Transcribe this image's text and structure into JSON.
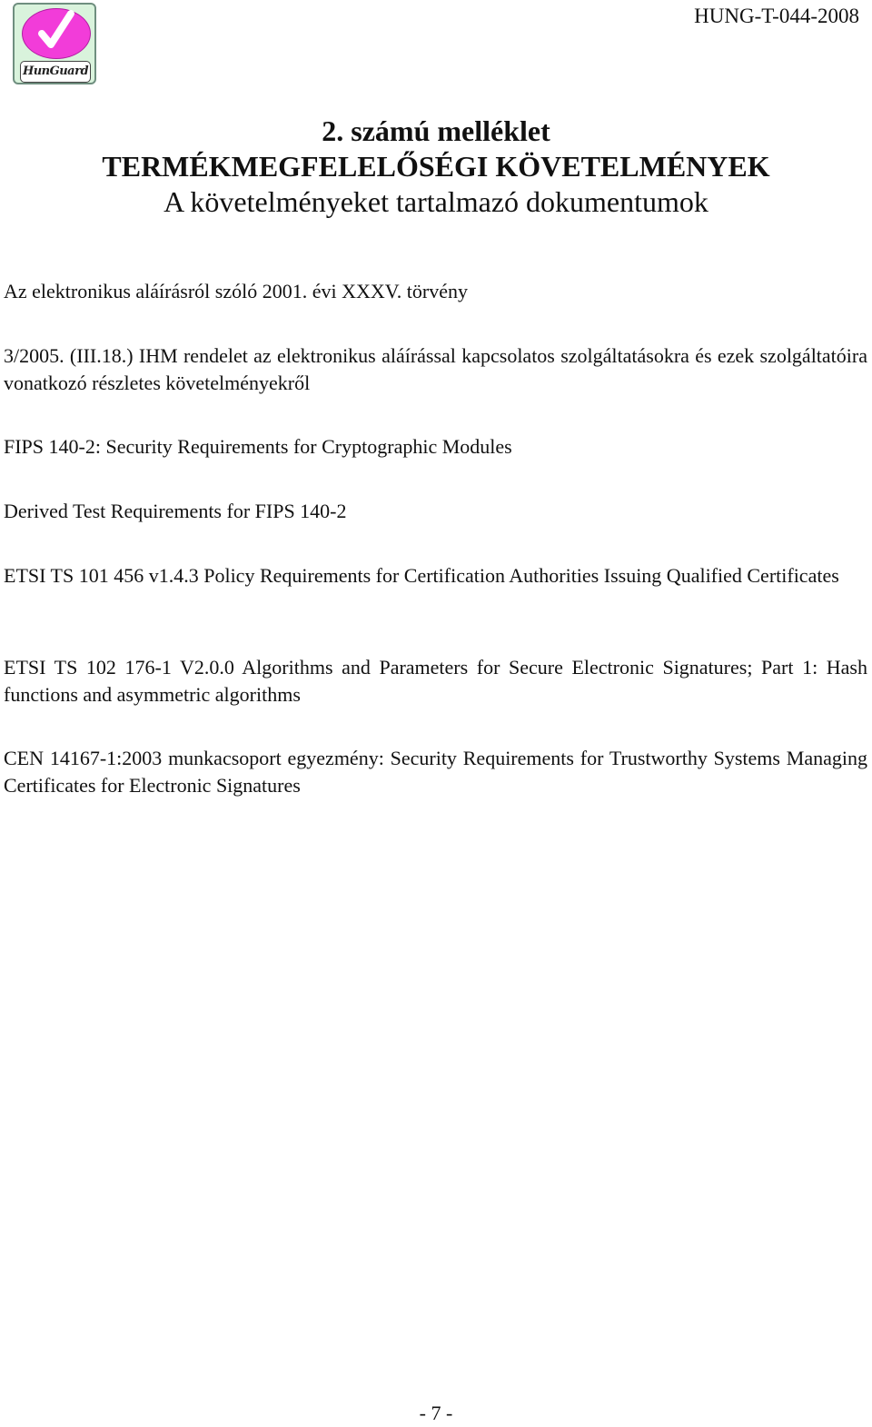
{
  "header": {
    "logo_text": "HunGuard",
    "doc_id": "HUNG-T-044-2008"
  },
  "title": {
    "line1": "2. számú melléklet",
    "line2": "TERMÉKMEGFELELŐSÉGI KÖVETELMÉNYEK",
    "line3": "A követelményeket tartalmazó dokumentumok"
  },
  "documents": [
    "Az elektronikus aláírásról szóló 2001. évi XXXV. törvény",
    "3/2005. (III.18.) IHM rendelet az elektronikus aláírással kapcsolatos szolgáltatásokra és ezek szolgáltatóira vonatkozó részletes követelményekről",
    "FIPS 140-2: Security Requirements for Cryptographic Modules",
    "Derived Test Requirements for FIPS 140-2",
    "ETSI TS 101 456 v1.4.3 Policy Requirements for Certification Authorities Issuing Qualified Certificates",
    "ETSI TS 102 176-1 V2.0.0 Algorithms and Parameters for Secure Electronic Signatures; Part 1: Hash functions and asymmetric algorithms",
    "CEN 14167-1:2003 munkacsoport egyezmény: Security Requirements for Trustworthy Systems Managing Certificates for Electronic Signatures"
  ],
  "footer": {
    "page_number": "- 7 -"
  },
  "colors": {
    "logo_magenta": "#f23cd9",
    "logo_background": "#d9f3dc"
  }
}
